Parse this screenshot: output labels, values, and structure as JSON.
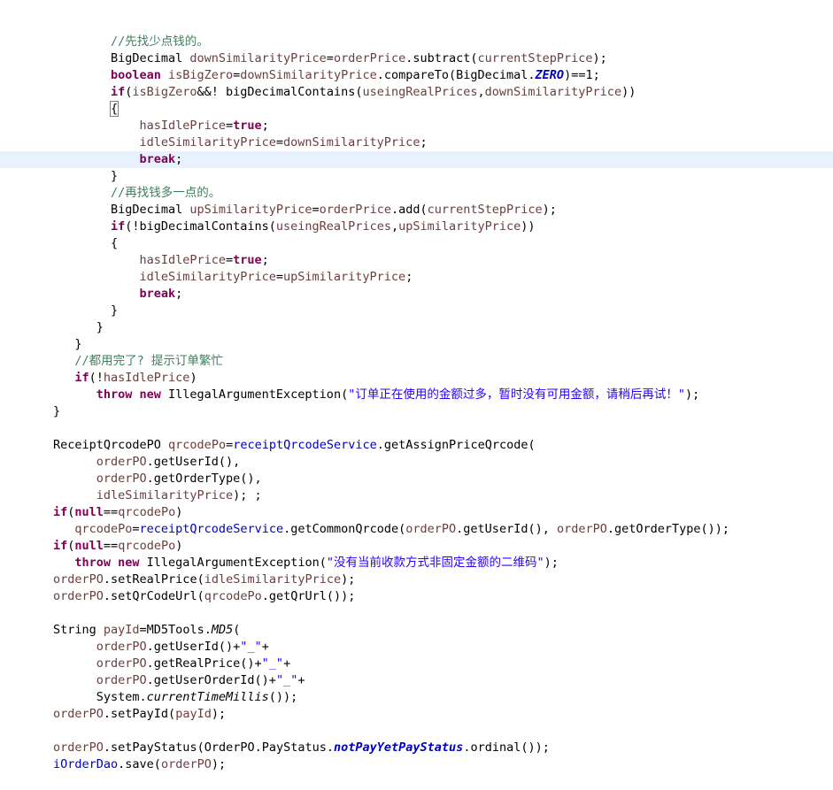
{
  "editor": {
    "language": "java",
    "background": "#ffffff",
    "highlight_color": "#e8f2fe",
    "colors": {
      "plain": "#000000",
      "comment": "#3f7f5f",
      "keyword": "#7f0055",
      "string": "#2a00ff",
      "field": "#0000c0",
      "static_field": "#0000c0",
      "local_variable": "#6a3e3e"
    },
    "highlighted_line_index": 7,
    "lines": [
      {
        "indent": 8,
        "tokens": [
          {
            "t": "comment",
            "v": "//先找少点钱的。"
          }
        ]
      },
      {
        "indent": 8,
        "tokens": [
          {
            "t": "type",
            "v": "BigDecimal "
          },
          {
            "t": "var",
            "v": "downSimilarityPrice"
          },
          {
            "t": "plain",
            "v": "="
          },
          {
            "t": "var",
            "v": "orderPrice"
          },
          {
            "t": "plain",
            "v": ".subtract("
          },
          {
            "t": "var",
            "v": "currentStepPrice"
          },
          {
            "t": "plain",
            "v": ");"
          }
        ]
      },
      {
        "indent": 8,
        "tokens": [
          {
            "t": "keyword",
            "v": "boolean"
          },
          {
            "t": "plain",
            "v": " "
          },
          {
            "t": "var",
            "v": "isBigZero"
          },
          {
            "t": "plain",
            "v": "="
          },
          {
            "t": "var",
            "v": "downSimilarityPrice"
          },
          {
            "t": "plain",
            "v": ".compareTo(BigDecimal."
          },
          {
            "t": "static",
            "v": "ZERO"
          },
          {
            "t": "plain",
            "v": ")==1;"
          }
        ]
      },
      {
        "indent": 8,
        "tokens": [
          {
            "t": "keyword",
            "v": "if"
          },
          {
            "t": "plain",
            "v": "("
          },
          {
            "t": "var",
            "v": "isBigZero"
          },
          {
            "t": "plain",
            "v": "&&! bigDecimalContains("
          },
          {
            "t": "var",
            "v": "useingRealPrices"
          },
          {
            "t": "plain",
            "v": ","
          },
          {
            "t": "var",
            "v": "downSimilarityPrice"
          },
          {
            "t": "plain",
            "v": "))"
          }
        ]
      },
      {
        "indent": 8,
        "brace": true,
        "tokens": [
          {
            "t": "plain",
            "v": "{"
          }
        ]
      },
      {
        "indent": 12,
        "tokens": [
          {
            "t": "var",
            "v": "hasIdlePrice"
          },
          {
            "t": "plain",
            "v": "="
          },
          {
            "t": "keyword",
            "v": "true"
          },
          {
            "t": "plain",
            "v": ";"
          }
        ]
      },
      {
        "indent": 12,
        "tokens": [
          {
            "t": "var",
            "v": "idleSimilarityPrice"
          },
          {
            "t": "plain",
            "v": "="
          },
          {
            "t": "var",
            "v": "downSimilarityPrice"
          },
          {
            "t": "plain",
            "v": ";"
          }
        ]
      },
      {
        "indent": 12,
        "tokens": [
          {
            "t": "keyword",
            "v": "break"
          },
          {
            "t": "plain",
            "v": ";"
          }
        ]
      },
      {
        "indent": 8,
        "tokens": [
          {
            "t": "plain",
            "v": "}"
          }
        ]
      },
      {
        "indent": 8,
        "tokens": [
          {
            "t": "comment",
            "v": "//再找钱多一点的。"
          }
        ]
      },
      {
        "indent": 8,
        "tokens": [
          {
            "t": "type",
            "v": "BigDecimal "
          },
          {
            "t": "var",
            "v": "upSimilarityPrice"
          },
          {
            "t": "plain",
            "v": "="
          },
          {
            "t": "var",
            "v": "orderPrice"
          },
          {
            "t": "plain",
            "v": ".add("
          },
          {
            "t": "var",
            "v": "currentStepPrice"
          },
          {
            "t": "plain",
            "v": ");"
          }
        ]
      },
      {
        "indent": 8,
        "tokens": [
          {
            "t": "keyword",
            "v": "if"
          },
          {
            "t": "plain",
            "v": "(!bigDecimalContains("
          },
          {
            "t": "var",
            "v": "useingRealPrices"
          },
          {
            "t": "plain",
            "v": ","
          },
          {
            "t": "var",
            "v": "upSimilarityPrice"
          },
          {
            "t": "plain",
            "v": "))"
          }
        ]
      },
      {
        "indent": 8,
        "tokens": [
          {
            "t": "plain",
            "v": "{"
          }
        ]
      },
      {
        "indent": 12,
        "tokens": [
          {
            "t": "var",
            "v": "hasIdlePrice"
          },
          {
            "t": "plain",
            "v": "="
          },
          {
            "t": "keyword",
            "v": "true"
          },
          {
            "t": "plain",
            "v": ";"
          }
        ]
      },
      {
        "indent": 12,
        "tokens": [
          {
            "t": "var",
            "v": "idleSimilarityPrice"
          },
          {
            "t": "plain",
            "v": "="
          },
          {
            "t": "var",
            "v": "upSimilarityPrice"
          },
          {
            "t": "plain",
            "v": ";"
          }
        ]
      },
      {
        "indent": 12,
        "tokens": [
          {
            "t": "keyword",
            "v": "break"
          },
          {
            "t": "plain",
            "v": ";"
          }
        ]
      },
      {
        "indent": 8,
        "tokens": [
          {
            "t": "plain",
            "v": "}"
          }
        ]
      },
      {
        "indent": 6,
        "tokens": [
          {
            "t": "plain",
            "v": "}"
          }
        ]
      },
      {
        "indent": 3,
        "tokens": [
          {
            "t": "plain",
            "v": "}"
          }
        ]
      },
      {
        "indent": 3,
        "tokens": [
          {
            "t": "comment",
            "v": "//都用完了? 提示订单繁忙"
          }
        ]
      },
      {
        "indent": 3,
        "tokens": [
          {
            "t": "keyword",
            "v": "if"
          },
          {
            "t": "plain",
            "v": "(!"
          },
          {
            "t": "var",
            "v": "hasIdlePrice"
          },
          {
            "t": "plain",
            "v": ")"
          }
        ]
      },
      {
        "indent": 6,
        "tokens": [
          {
            "t": "keyword",
            "v": "throw new"
          },
          {
            "t": "plain",
            "v": " IllegalArgumentException("
          },
          {
            "t": "string",
            "v": "\"订单正在使用的金额过多，暂时没有可用金额，请稍后再试！\""
          },
          {
            "t": "plain",
            "v": ");"
          }
        ]
      },
      {
        "indent": 0,
        "tokens": [
          {
            "t": "plain",
            "v": "}"
          }
        ]
      },
      {
        "indent": 0,
        "tokens": []
      },
      {
        "indent": 0,
        "tokens": [
          {
            "t": "type",
            "v": "ReceiptQrcodePO "
          },
          {
            "t": "var",
            "v": "qrcodePo"
          },
          {
            "t": "plain",
            "v": "="
          },
          {
            "t": "field",
            "v": "receiptQrcodeService"
          },
          {
            "t": "plain",
            "v": ".getAssignPriceQrcode("
          }
        ]
      },
      {
        "indent": 6,
        "tokens": [
          {
            "t": "var",
            "v": "orderPO"
          },
          {
            "t": "plain",
            "v": ".getUserId(),"
          }
        ]
      },
      {
        "indent": 6,
        "tokens": [
          {
            "t": "var",
            "v": "orderPO"
          },
          {
            "t": "plain",
            "v": ".getOrderType(),"
          }
        ]
      },
      {
        "indent": 6,
        "tokens": [
          {
            "t": "var",
            "v": "idleSimilarityPrice"
          },
          {
            "t": "plain",
            "v": "); ;"
          }
        ]
      },
      {
        "indent": 0,
        "tokens": [
          {
            "t": "keyword",
            "v": "if"
          },
          {
            "t": "plain",
            "v": "("
          },
          {
            "t": "keyword",
            "v": "null"
          },
          {
            "t": "plain",
            "v": "=="
          },
          {
            "t": "var",
            "v": "qrcodePo"
          },
          {
            "t": "plain",
            "v": ")"
          }
        ]
      },
      {
        "indent": 3,
        "tokens": [
          {
            "t": "var",
            "v": "qrcodePo"
          },
          {
            "t": "plain",
            "v": "="
          },
          {
            "t": "field",
            "v": "receiptQrcodeService"
          },
          {
            "t": "plain",
            "v": ".getCommonQrcode("
          },
          {
            "t": "var",
            "v": "orderPO"
          },
          {
            "t": "plain",
            "v": ".getUserId(), "
          },
          {
            "t": "var",
            "v": "orderPO"
          },
          {
            "t": "plain",
            "v": ".getOrderType());"
          }
        ]
      },
      {
        "indent": 0,
        "tokens": [
          {
            "t": "keyword",
            "v": "if"
          },
          {
            "t": "plain",
            "v": "("
          },
          {
            "t": "keyword",
            "v": "null"
          },
          {
            "t": "plain",
            "v": "=="
          },
          {
            "t": "var",
            "v": "qrcodePo"
          },
          {
            "t": "plain",
            "v": ")"
          }
        ]
      },
      {
        "indent": 3,
        "tokens": [
          {
            "t": "keyword",
            "v": "throw new"
          },
          {
            "t": "plain",
            "v": " IllegalArgumentException("
          },
          {
            "t": "string",
            "v": "\"没有当前收款方式非固定金额的二维码\""
          },
          {
            "t": "plain",
            "v": ");"
          }
        ]
      },
      {
        "indent": 0,
        "tokens": [
          {
            "t": "var",
            "v": "orderPO"
          },
          {
            "t": "plain",
            "v": ".setRealPrice("
          },
          {
            "t": "var",
            "v": "idleSimilarityPrice"
          },
          {
            "t": "plain",
            "v": ");"
          }
        ]
      },
      {
        "indent": 0,
        "tokens": [
          {
            "t": "var",
            "v": "orderPO"
          },
          {
            "t": "plain",
            "v": ".setQrCodeUrl("
          },
          {
            "t": "var",
            "v": "qrcodePo"
          },
          {
            "t": "plain",
            "v": ".getQrUrl());"
          }
        ]
      },
      {
        "indent": 0,
        "tokens": []
      },
      {
        "indent": 0,
        "tokens": [
          {
            "t": "type",
            "v": "String "
          },
          {
            "t": "var",
            "v": "payId"
          },
          {
            "t": "plain",
            "v": "=MD5Tools."
          },
          {
            "t": "staticm",
            "v": "MD5"
          },
          {
            "t": "plain",
            "v": "("
          }
        ]
      },
      {
        "indent": 6,
        "tokens": [
          {
            "t": "var",
            "v": "orderPO"
          },
          {
            "t": "plain",
            "v": ".getUserId()+"
          },
          {
            "t": "string",
            "v": "\"_\""
          },
          {
            "t": "plain",
            "v": "+"
          }
        ]
      },
      {
        "indent": 6,
        "tokens": [
          {
            "t": "var",
            "v": "orderPO"
          },
          {
            "t": "plain",
            "v": ".getRealPrice()+"
          },
          {
            "t": "string",
            "v": "\"_\""
          },
          {
            "t": "plain",
            "v": "+"
          }
        ]
      },
      {
        "indent": 6,
        "tokens": [
          {
            "t": "var",
            "v": "orderPO"
          },
          {
            "t": "plain",
            "v": ".getUserOrderId()+"
          },
          {
            "t": "string",
            "v": "\"_\""
          },
          {
            "t": "plain",
            "v": "+"
          }
        ]
      },
      {
        "indent": 6,
        "tokens": [
          {
            "t": "plain",
            "v": "System."
          },
          {
            "t": "staticm",
            "v": "currentTimeMillis"
          },
          {
            "t": "plain",
            "v": "());"
          }
        ]
      },
      {
        "indent": 0,
        "tokens": [
          {
            "t": "var",
            "v": "orderPO"
          },
          {
            "t": "plain",
            "v": ".setPayId("
          },
          {
            "t": "var",
            "v": "payId"
          },
          {
            "t": "plain",
            "v": ");"
          }
        ]
      },
      {
        "indent": 0,
        "tokens": []
      },
      {
        "indent": 0,
        "tokens": [
          {
            "t": "var",
            "v": "orderPO"
          },
          {
            "t": "plain",
            "v": ".setPayStatus(OrderPO.PayStatus."
          },
          {
            "t": "static",
            "v": "notPayYetPayStatus"
          },
          {
            "t": "plain",
            "v": ".ordinal());"
          }
        ]
      },
      {
        "indent": 0,
        "tokens": [
          {
            "t": "field",
            "v": "iOrderDao"
          },
          {
            "t": "plain",
            "v": ".save("
          },
          {
            "t": "var",
            "v": "orderPO"
          },
          {
            "t": "plain",
            "v": ");"
          }
        ]
      }
    ]
  }
}
